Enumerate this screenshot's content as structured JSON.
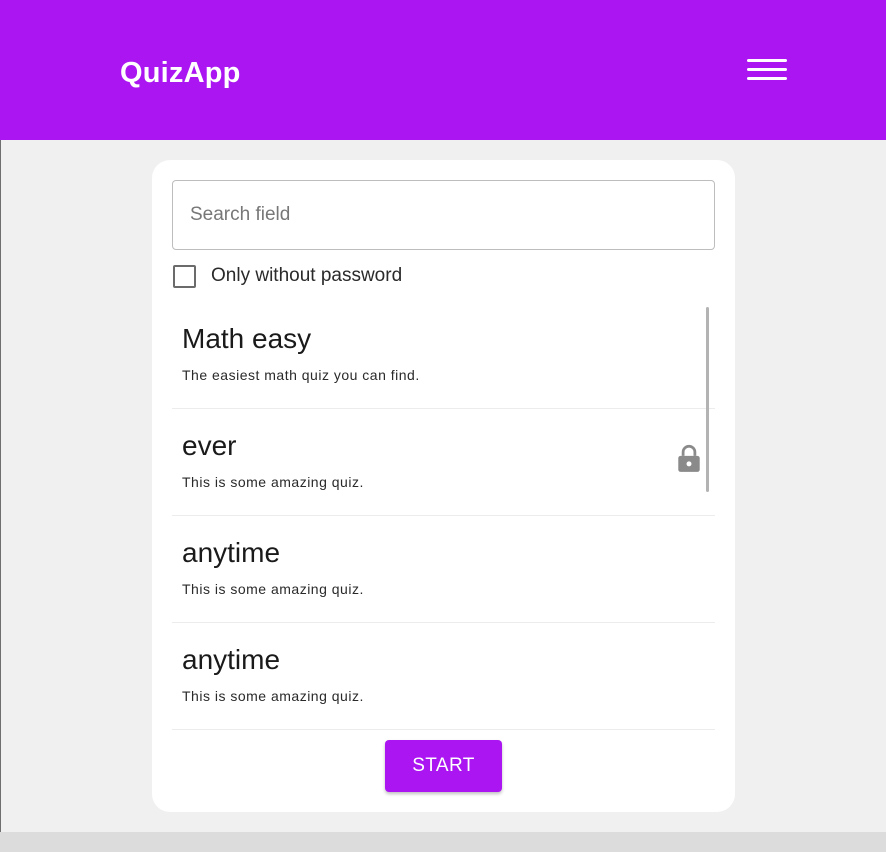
{
  "header": {
    "title": "QuizApp",
    "menu_icon": "hamburger-menu-icon"
  },
  "search": {
    "placeholder": "Search field",
    "value": ""
  },
  "filter": {
    "label": "Only without password",
    "checked": false
  },
  "quizzes": [
    {
      "title": "Math easy",
      "description": "The easiest math quiz you can find.",
      "locked": false
    },
    {
      "title": "ever",
      "description": "This is some amazing quiz.",
      "locked": true
    },
    {
      "title": "anytime",
      "description": "This is some amazing quiz.",
      "locked": false
    },
    {
      "title": "anytime",
      "description": "This is some amazing quiz.",
      "locked": false
    }
  ],
  "actions": {
    "start_label": "START"
  },
  "colors": {
    "primary": "#aa15f2",
    "background": "#f0f0f0",
    "card": "#ffffff",
    "lock": "#8a8a8a"
  }
}
